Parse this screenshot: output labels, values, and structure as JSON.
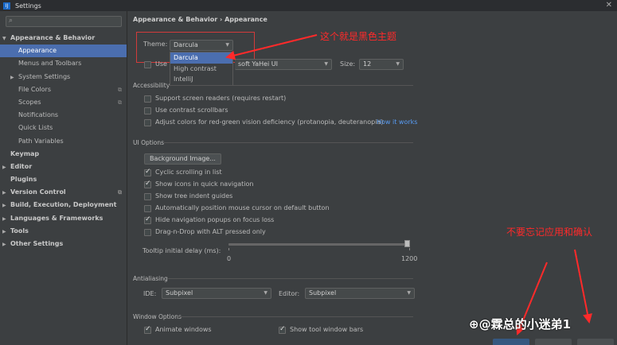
{
  "window": {
    "title": "Settings",
    "app_icon": "IJ"
  },
  "search": {
    "icon": "search-icon"
  },
  "tree": [
    {
      "label": "Appearance & Behavior",
      "level": 0,
      "arrow": "▼",
      "bold": true
    },
    {
      "label": "Appearance",
      "level": 1,
      "selected": true
    },
    {
      "label": "Menus and Toolbars",
      "level": 1
    },
    {
      "label": "System Settings",
      "level": 1,
      "arrow": "▶"
    },
    {
      "label": "File Colors",
      "level": 1,
      "icon": true
    },
    {
      "label": "Scopes",
      "level": 1,
      "icon": true
    },
    {
      "label": "Notifications",
      "level": 1
    },
    {
      "label": "Quick Lists",
      "level": 1
    },
    {
      "label": "Path Variables",
      "level": 1
    },
    {
      "label": "Keymap",
      "level": 0,
      "bold": true
    },
    {
      "label": "Editor",
      "level": 0,
      "arrow": "▶",
      "bold": true
    },
    {
      "label": "Plugins",
      "level": 0,
      "bold": true
    },
    {
      "label": "Version Control",
      "level": 0,
      "arrow": "▶",
      "bold": true,
      "icon": true
    },
    {
      "label": "Build, Execution, Deployment",
      "level": 0,
      "arrow": "▶",
      "bold": true
    },
    {
      "label": "Languages & Frameworks",
      "level": 0,
      "arrow": "▶",
      "bold": true
    },
    {
      "label": "Tools",
      "level": 0,
      "arrow": "▶",
      "bold": true
    },
    {
      "label": "Other Settings",
      "level": 0,
      "arrow": "▶",
      "bold": true
    }
  ],
  "breadcrumb": "Appearance & Behavior  ›  Appearance",
  "theme": {
    "label": "Theme:",
    "value": "Darcula",
    "options": [
      "Darcula",
      "High contrast",
      "IntelliJ"
    ],
    "selected_index": 0
  },
  "font": {
    "use_label": "Use",
    "value": "soft YaHei UI",
    "size_label": "Size:",
    "size_value": "12"
  },
  "accessibility": {
    "title": "Accessibility",
    "items": [
      {
        "label": "Support screen readers (requires restart)",
        "checked": false
      },
      {
        "label": "Use contrast scrollbars",
        "checked": false
      },
      {
        "label": "Adjust colors for red-green vision deficiency (protanopia, deuteranopia)",
        "checked": false,
        "link": "How it works"
      }
    ]
  },
  "ui_options": {
    "title": "UI Options",
    "background_button": "Background Image...",
    "items": [
      {
        "label": "Cyclic scrolling in list",
        "checked": true
      },
      {
        "label": "Show icons in quick navigation",
        "checked": true
      },
      {
        "label": "Show tree indent guides",
        "checked": false
      },
      {
        "label": "Automatically position mouse cursor on default button",
        "checked": false
      },
      {
        "label": "Hide navigation popups on focus loss",
        "checked": true
      },
      {
        "label": "Drag-n-Drop with ALT pressed only",
        "checked": false
      }
    ],
    "tooltip_label": "Tooltip initial delay (ms):",
    "tooltip_min": "0",
    "tooltip_max": "1200",
    "tooltip_value_fraction": 1.0
  },
  "antialiasing": {
    "title": "Antialiasing",
    "ide_label": "IDE:",
    "ide_value": "Subpixel",
    "editor_label": "Editor:",
    "editor_value": "Subpixel"
  },
  "window_options": {
    "title": "Window Options",
    "animate_label": "Animate windows",
    "animate_checked": true,
    "toolwin_label": "Show tool window bars",
    "toolwin_checked": true
  },
  "annotations": {
    "top": "这个就是黑色主题",
    "right": "不要忘记应用和确认",
    "color": "#ff2a2a"
  },
  "watermark": "⊕@霖总的小迷弟1"
}
